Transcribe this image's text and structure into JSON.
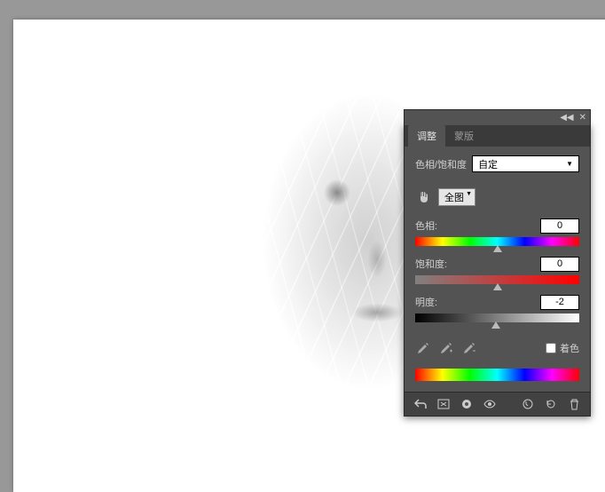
{
  "panel": {
    "tabs": {
      "adjustments": "调整",
      "masks": "蒙版",
      "active": 0
    },
    "title": "色相/饱和度",
    "preset": "自定",
    "range": "全图",
    "sliders": {
      "hue": {
        "label": "色相:",
        "value": "0",
        "pos": 50
      },
      "saturation": {
        "label": "饱和度:",
        "value": "0",
        "pos": 50
      },
      "lightness": {
        "label": "明度:",
        "value": "-2",
        "pos": 49
      }
    },
    "colorize": "着色"
  }
}
